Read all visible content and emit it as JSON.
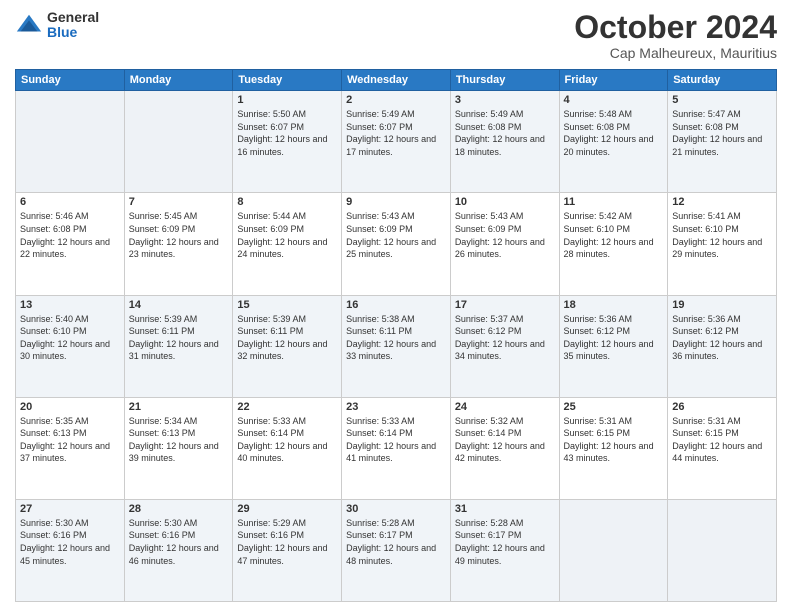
{
  "logo": {
    "general": "General",
    "blue": "Blue"
  },
  "header": {
    "month": "October 2024",
    "location": "Cap Malheureux, Mauritius"
  },
  "days_of_week": [
    "Sunday",
    "Monday",
    "Tuesday",
    "Wednesday",
    "Thursday",
    "Friday",
    "Saturday"
  ],
  "weeks": [
    [
      {
        "day": "",
        "sunrise": "",
        "sunset": "",
        "daylight": ""
      },
      {
        "day": "",
        "sunrise": "",
        "sunset": "",
        "daylight": ""
      },
      {
        "day": "1",
        "sunrise": "Sunrise: 5:50 AM",
        "sunset": "Sunset: 6:07 PM",
        "daylight": "Daylight: 12 hours and 16 minutes."
      },
      {
        "day": "2",
        "sunrise": "Sunrise: 5:49 AM",
        "sunset": "Sunset: 6:07 PM",
        "daylight": "Daylight: 12 hours and 17 minutes."
      },
      {
        "day": "3",
        "sunrise": "Sunrise: 5:49 AM",
        "sunset": "Sunset: 6:08 PM",
        "daylight": "Daylight: 12 hours and 18 minutes."
      },
      {
        "day": "4",
        "sunrise": "Sunrise: 5:48 AM",
        "sunset": "Sunset: 6:08 PM",
        "daylight": "Daylight: 12 hours and 20 minutes."
      },
      {
        "day": "5",
        "sunrise": "Sunrise: 5:47 AM",
        "sunset": "Sunset: 6:08 PM",
        "daylight": "Daylight: 12 hours and 21 minutes."
      }
    ],
    [
      {
        "day": "6",
        "sunrise": "Sunrise: 5:46 AM",
        "sunset": "Sunset: 6:08 PM",
        "daylight": "Daylight: 12 hours and 22 minutes."
      },
      {
        "day": "7",
        "sunrise": "Sunrise: 5:45 AM",
        "sunset": "Sunset: 6:09 PM",
        "daylight": "Daylight: 12 hours and 23 minutes."
      },
      {
        "day": "8",
        "sunrise": "Sunrise: 5:44 AM",
        "sunset": "Sunset: 6:09 PM",
        "daylight": "Daylight: 12 hours and 24 minutes."
      },
      {
        "day": "9",
        "sunrise": "Sunrise: 5:43 AM",
        "sunset": "Sunset: 6:09 PM",
        "daylight": "Daylight: 12 hours and 25 minutes."
      },
      {
        "day": "10",
        "sunrise": "Sunrise: 5:43 AM",
        "sunset": "Sunset: 6:09 PM",
        "daylight": "Daylight: 12 hours and 26 minutes."
      },
      {
        "day": "11",
        "sunrise": "Sunrise: 5:42 AM",
        "sunset": "Sunset: 6:10 PM",
        "daylight": "Daylight: 12 hours and 28 minutes."
      },
      {
        "day": "12",
        "sunrise": "Sunrise: 5:41 AM",
        "sunset": "Sunset: 6:10 PM",
        "daylight": "Daylight: 12 hours and 29 minutes."
      }
    ],
    [
      {
        "day": "13",
        "sunrise": "Sunrise: 5:40 AM",
        "sunset": "Sunset: 6:10 PM",
        "daylight": "Daylight: 12 hours and 30 minutes."
      },
      {
        "day": "14",
        "sunrise": "Sunrise: 5:39 AM",
        "sunset": "Sunset: 6:11 PM",
        "daylight": "Daylight: 12 hours and 31 minutes."
      },
      {
        "day": "15",
        "sunrise": "Sunrise: 5:39 AM",
        "sunset": "Sunset: 6:11 PM",
        "daylight": "Daylight: 12 hours and 32 minutes."
      },
      {
        "day": "16",
        "sunrise": "Sunrise: 5:38 AM",
        "sunset": "Sunset: 6:11 PM",
        "daylight": "Daylight: 12 hours and 33 minutes."
      },
      {
        "day": "17",
        "sunrise": "Sunrise: 5:37 AM",
        "sunset": "Sunset: 6:12 PM",
        "daylight": "Daylight: 12 hours and 34 minutes."
      },
      {
        "day": "18",
        "sunrise": "Sunrise: 5:36 AM",
        "sunset": "Sunset: 6:12 PM",
        "daylight": "Daylight: 12 hours and 35 minutes."
      },
      {
        "day": "19",
        "sunrise": "Sunrise: 5:36 AM",
        "sunset": "Sunset: 6:12 PM",
        "daylight": "Daylight: 12 hours and 36 minutes."
      }
    ],
    [
      {
        "day": "20",
        "sunrise": "Sunrise: 5:35 AM",
        "sunset": "Sunset: 6:13 PM",
        "daylight": "Daylight: 12 hours and 37 minutes."
      },
      {
        "day": "21",
        "sunrise": "Sunrise: 5:34 AM",
        "sunset": "Sunset: 6:13 PM",
        "daylight": "Daylight: 12 hours and 39 minutes."
      },
      {
        "day": "22",
        "sunrise": "Sunrise: 5:33 AM",
        "sunset": "Sunset: 6:14 PM",
        "daylight": "Daylight: 12 hours and 40 minutes."
      },
      {
        "day": "23",
        "sunrise": "Sunrise: 5:33 AM",
        "sunset": "Sunset: 6:14 PM",
        "daylight": "Daylight: 12 hours and 41 minutes."
      },
      {
        "day": "24",
        "sunrise": "Sunrise: 5:32 AM",
        "sunset": "Sunset: 6:14 PM",
        "daylight": "Daylight: 12 hours and 42 minutes."
      },
      {
        "day": "25",
        "sunrise": "Sunrise: 5:31 AM",
        "sunset": "Sunset: 6:15 PM",
        "daylight": "Daylight: 12 hours and 43 minutes."
      },
      {
        "day": "26",
        "sunrise": "Sunrise: 5:31 AM",
        "sunset": "Sunset: 6:15 PM",
        "daylight": "Daylight: 12 hours and 44 minutes."
      }
    ],
    [
      {
        "day": "27",
        "sunrise": "Sunrise: 5:30 AM",
        "sunset": "Sunset: 6:16 PM",
        "daylight": "Daylight: 12 hours and 45 minutes."
      },
      {
        "day": "28",
        "sunrise": "Sunrise: 5:30 AM",
        "sunset": "Sunset: 6:16 PM",
        "daylight": "Daylight: 12 hours and 46 minutes."
      },
      {
        "day": "29",
        "sunrise": "Sunrise: 5:29 AM",
        "sunset": "Sunset: 6:16 PM",
        "daylight": "Daylight: 12 hours and 47 minutes."
      },
      {
        "day": "30",
        "sunrise": "Sunrise: 5:28 AM",
        "sunset": "Sunset: 6:17 PM",
        "daylight": "Daylight: 12 hours and 48 minutes."
      },
      {
        "day": "31",
        "sunrise": "Sunrise: 5:28 AM",
        "sunset": "Sunset: 6:17 PM",
        "daylight": "Daylight: 12 hours and 49 minutes."
      },
      {
        "day": "",
        "sunrise": "",
        "sunset": "",
        "daylight": ""
      },
      {
        "day": "",
        "sunrise": "",
        "sunset": "",
        "daylight": ""
      }
    ]
  ]
}
